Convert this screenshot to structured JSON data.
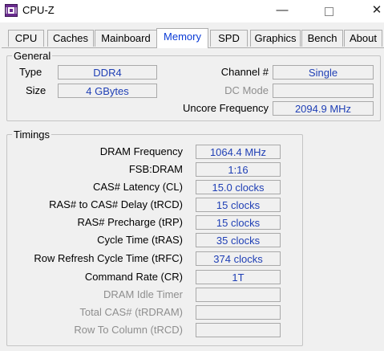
{
  "window": {
    "title": "CPU-Z",
    "minimize_glyph": "—",
    "close_glyph": "✕",
    "icon": "cpu-z-app-icon"
  },
  "tabs": [
    {
      "label": "CPU",
      "active": false
    },
    {
      "label": "Caches",
      "active": false
    },
    {
      "label": "Mainboard",
      "active": false
    },
    {
      "label": "Memory",
      "active": true
    },
    {
      "label": "SPD",
      "active": false
    },
    {
      "label": "Graphics",
      "active": false
    },
    {
      "label": "Bench",
      "active": false
    },
    {
      "label": "About",
      "active": false
    }
  ],
  "general": {
    "legend": "General",
    "type_label": "Type",
    "type_value": "DDR4",
    "size_label": "Size",
    "size_value": "4 GBytes",
    "channel_label": "Channel #",
    "channel_value": "Single",
    "dcmode_label": "DC Mode",
    "dcmode_value": "",
    "uncore_label": "Uncore Frequency",
    "uncore_value": "2094.9 MHz"
  },
  "timings": {
    "legend": "Timings",
    "rows": [
      {
        "label": "DRAM Frequency",
        "value": "1064.4 MHz",
        "enabled": true
      },
      {
        "label": "FSB:DRAM",
        "value": "1:16",
        "enabled": true
      },
      {
        "label": "CAS# Latency (CL)",
        "value": "15.0 clocks",
        "enabled": true
      },
      {
        "label": "RAS# to CAS# Delay (tRCD)",
        "value": "15 clocks",
        "enabled": true
      },
      {
        "label": "RAS# Precharge (tRP)",
        "value": "15 clocks",
        "enabled": true
      },
      {
        "label": "Cycle Time (tRAS)",
        "value": "35 clocks",
        "enabled": true
      },
      {
        "label": "Row Refresh Cycle Time (tRFC)",
        "value": "374 clocks",
        "enabled": true
      },
      {
        "label": "Command Rate (CR)",
        "value": "1T",
        "enabled": true
      },
      {
        "label": "DRAM Idle Timer",
        "value": "",
        "enabled": false
      },
      {
        "label": "Total CAS# (tRDRAM)",
        "value": "",
        "enabled": false
      },
      {
        "label": "Row To Column (tRCD)",
        "value": "",
        "enabled": false
      }
    ]
  },
  "colors": {
    "value_text": "#1f3fb5",
    "active_tab_text": "#0a3bd6",
    "disabled_label": "#8e8e8e"
  }
}
